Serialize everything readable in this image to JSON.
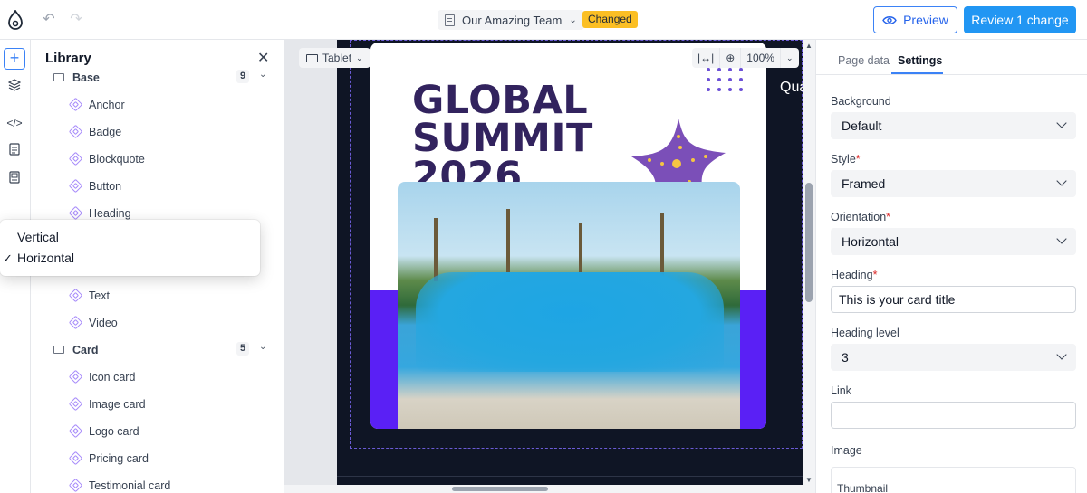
{
  "topbar": {
    "page_title": "Our Amazing Team",
    "status_badge": "Changed",
    "preview_label": "Preview",
    "review_label": "Review 1 change",
    "accent_color": "#2196f3"
  },
  "rail": {
    "items": [
      "add-icon",
      "layers-icon",
      "code-icon",
      "page-icon",
      "pattern-icon"
    ]
  },
  "library": {
    "title": "Library",
    "groups": [
      {
        "label": "Base",
        "count": "9",
        "items": [
          "Anchor",
          "Badge",
          "Blockquote",
          "Button",
          "Heading",
          "Text",
          "Video"
        ]
      },
      {
        "label": "Card",
        "count": "5",
        "items": [
          "Icon card",
          "Image card",
          "Logo card",
          "Pricing card",
          "Testimonial card"
        ]
      }
    ]
  },
  "popup": {
    "options": [
      "Vertical",
      "Horizontal"
    ],
    "selected": "Horizontal",
    "check": "✓"
  },
  "canvas": {
    "device_label": "Tablet",
    "zoom_label": "100%",
    "card_heading_lines": [
      "GLOBAL",
      "SUMMIT",
      "2026"
    ],
    "side_text": "Qua"
  },
  "settings": {
    "tabs": [
      "Page data",
      "Settings"
    ],
    "active_tab": "Settings",
    "fields": {
      "background": {
        "label": "Background",
        "value": "Default"
      },
      "style": {
        "label": "Style",
        "value": "Framed"
      },
      "orientation": {
        "label": "Orientation",
        "value": "Horizontal"
      },
      "heading": {
        "label": "Heading",
        "value": "This is your card title"
      },
      "heading_level": {
        "label": "Heading level",
        "value": "3"
      },
      "link": {
        "label": "Link",
        "value": ""
      },
      "image": {
        "label": "Image",
        "thumbnail_label": "Thumbnail"
      }
    },
    "required_mark": "*"
  }
}
